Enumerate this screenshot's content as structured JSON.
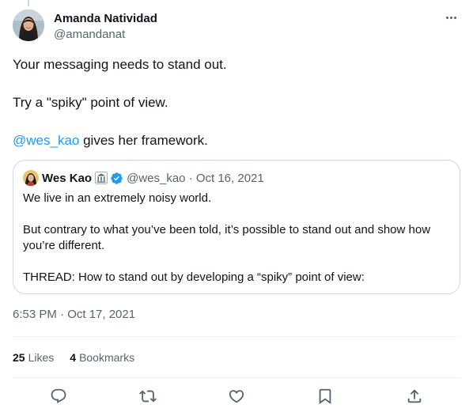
{
  "tweet": {
    "author_name": "Amanda Natividad",
    "author_handle": "@amandanat",
    "body": {
      "line1": "Your messaging needs to stand out.",
      "line2": "Try a \"spiky\" point of view.",
      "mention": "@wes_kao",
      "line3_rest": " gives her framework."
    },
    "timestamp": "6:53 PM · Oct 17, 2021",
    "menu_icon": "more-horizontal-icon"
  },
  "quoted": {
    "author_name": "Wes Kao",
    "affiliation_icon": "institution-icon",
    "verified_icon": "verified-badge-icon",
    "meta": "@wes_kao · Oct 16, 2021",
    "para1": "We live in an extremely noisy world.",
    "para2": "But contrary to what you’ve been told, it’s possible to stand out and show how you’re different.",
    "para3": "THREAD: How to stand out by developing a “spiky” point of view:"
  },
  "stats": {
    "likes_count": "25",
    "likes_label": "Likes",
    "bookmarks_count": "4",
    "bookmarks_label": "Bookmarks"
  },
  "actions": [
    {
      "name": "reply",
      "icon": "reply-icon"
    },
    {
      "name": "retweet",
      "icon": "retweet-icon"
    },
    {
      "name": "like",
      "icon": "heart-icon"
    },
    {
      "name": "bookmark",
      "icon": "bookmark-icon"
    },
    {
      "name": "share",
      "icon": "share-icon"
    }
  ],
  "colors": {
    "text": "#0f1419",
    "secondary": "#536471",
    "accent": "#1d9bf0",
    "border": "#cfd9de",
    "divider": "#eff3f4"
  }
}
